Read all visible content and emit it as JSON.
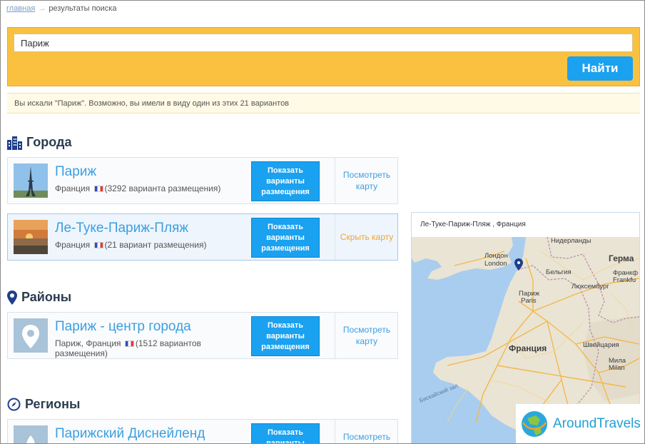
{
  "breadcrumb": {
    "home": "главная",
    "current": "результаты поиска"
  },
  "search": {
    "value": "Париж",
    "button": "Найти"
  },
  "notice": "Вы искали \"Париж\". Возможно, вы имели в виду один из этих 21 вариантов",
  "sections": {
    "cities": "Города",
    "districts": "Районы",
    "regions": "Регионы"
  },
  "cards": [
    {
      "title": "Париж",
      "country": "Франция",
      "count": "(3292 варианта размещения)",
      "show": "Показать варианты размещения",
      "map": "Посмотреть карту"
    },
    {
      "title": "Ле-Туке-Париж-Пляж",
      "country": "Франция",
      "count": "(21 вариант размещения)",
      "show": "Показать варианты размещения",
      "map": "Скрыть карту"
    },
    {
      "title": "Париж - центр города",
      "country": "Париж, Франция",
      "count": "(1512 вариантов размещения)",
      "show": "Показать варианты размещения",
      "map": "Посмотреть карту"
    },
    {
      "title": "Парижский Диснейленд",
      "show": "Показать варианты размещения",
      "map": "Посмотреть"
    }
  ],
  "map": {
    "title": "Ле-Туке-Париж-Пляж , Франция",
    "labels": {
      "netherlands": "Нидерланды",
      "london_ru": "Лондон",
      "london_en": "London",
      "germany": "Герма",
      "belgium": "Бельгия",
      "frankfurt_ru": "Франкф",
      "frankfurt_en": "Frankfu",
      "luxembourg": "Люксембург",
      "paris_ru": "Париж",
      "paris_en": "Paris",
      "france": "Франция",
      "switzerland": "Швейцария",
      "milan_ru": "Мила",
      "milan_en": "Milan",
      "bay": "Бискайский зал"
    }
  },
  "watermark": "AroundTravels",
  "colors": {
    "accent": "#1aa1f0",
    "search_bg": "#f9c13f",
    "link": "#3b9fe0",
    "hide_link": "#f0a532"
  }
}
